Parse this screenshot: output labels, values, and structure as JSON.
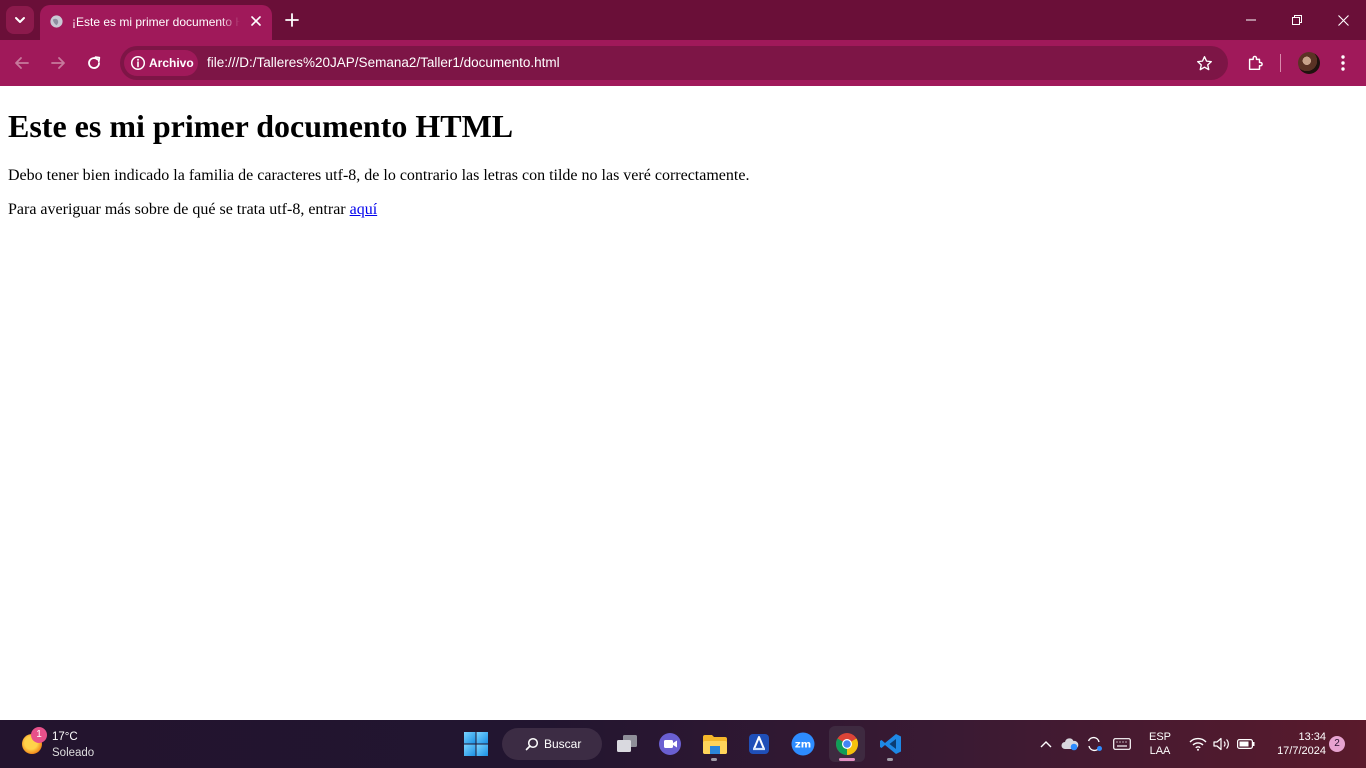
{
  "browser": {
    "tab": {
      "title": "¡Este es mi primer documento HTML"
    },
    "omnibox": {
      "chip_label": "Archivo",
      "url": "file:///D:/Talleres%20JAP/Semana2/Taller1/documento.html"
    },
    "colors": {
      "tabstrip": "#6a0f38",
      "toolbar": "#a0195a"
    }
  },
  "page": {
    "heading": "Este es mi primer documento HTML",
    "paragraph1": "Debo tener bien indicado la familia de caracteres utf-8, de lo contrario las letras con tilde no las veré correctamente.",
    "paragraph2_text": "Para averiguar más sobre de qué se trata utf-8, entrar ",
    "link_text": "aquí"
  },
  "taskbar": {
    "weather": {
      "temperature": "17°C",
      "condition": "Soleado",
      "badge": "1"
    },
    "search_label": "Buscar",
    "apps": [
      "task-view",
      "teams-meet",
      "file-explorer",
      "snipping",
      "zoom",
      "chrome",
      "vscode"
    ],
    "tray": {
      "lang_line1": "ESP",
      "lang_line2": "LAA",
      "time": "13:34",
      "date": "17/7/2024",
      "notification_count": "2"
    }
  }
}
